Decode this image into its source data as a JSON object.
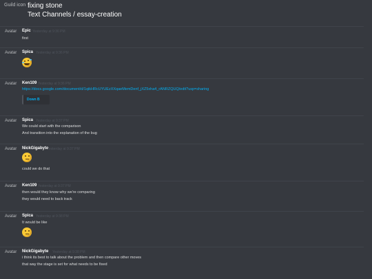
{
  "header": {
    "guild_icon_label": "Guild icon",
    "guild_name": "fixing stone",
    "channel_path": "Text Channels / essay-creation"
  },
  "avatar_label": "Avatar",
  "messages": [
    {
      "author": "Epic",
      "timestamp": "Yesterday at 9:36 PM",
      "lines": [
        "first"
      ]
    },
    {
      "author": "Spica",
      "timestamp": "Yesterday at 9:36 PM",
      "emoji": "rolling-on-floor-laughing-emoji"
    },
    {
      "author": "Ken109",
      "timestamp": "Yesterday at 9:36 PM",
      "lines": [
        "https://docs.google.com/document/d/1qikHRcUYUEzXXqaeMemDenf_jXZ5xha4_rANRZQUQ/edit?usp=sharing"
      ],
      "embed": "Down B"
    },
    {
      "author": "Spica",
      "timestamp": "Yesterday at 9:37 PM",
      "lines": [
        "We could start with the comparison",
        "And transition into the explanation of the bug"
      ]
    },
    {
      "author": "NickGigabyte",
      "timestamp": "Yesterday at 9:37 PM",
      "emoji": "thinking-face-emoji",
      "lines": [
        "could we do that"
      ]
    },
    {
      "author": "Ken109",
      "timestamp": "Yesterday at 9:37 PM",
      "lines": [
        "then would they know why we're comparing",
        "they would need to back track"
      ]
    },
    {
      "author": "Spica",
      "timestamp": "Yesterday at 9:38 PM",
      "lines": [
        "It would be like"
      ],
      "emoji": "thinking-face-emoji"
    },
    {
      "author": "NickGigabyte",
      "timestamp": "Yesterday at 9:38 PM",
      "lines": [
        "i think its best to talk about the problem and then compare other moves",
        "that way the stage is set for what needs to be fixed"
      ]
    }
  ]
}
